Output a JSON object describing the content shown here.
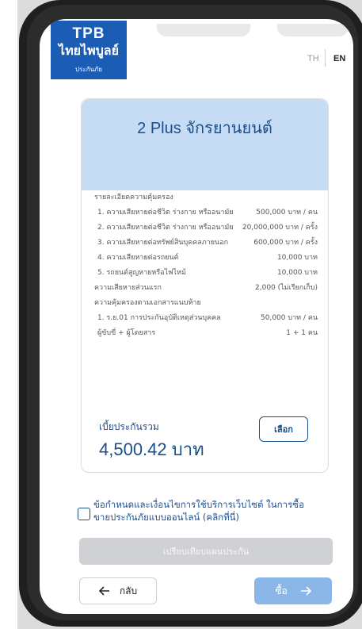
{
  "header": {
    "logo_line1": "TPB",
    "logo_line2": "ไทยไพบูลย์",
    "logo_line3": "ประกันภัย",
    "lang_th": "TH",
    "lang_en": "EN"
  },
  "plan": {
    "title": "2 Plus จักรยานยนต์",
    "coverage_heading": "รายละเอียดความคุ้มครอง",
    "items": [
      {
        "label": "1. ความเสียหายต่อชีวิต ร่างกาย หรืออนามัย",
        "value": "500,000 บาท / คน"
      },
      {
        "label": "2. ความเสียหายต่อชีวิต ร่างกาย หรืออนามัย",
        "value": "20,000,000 บาท / ครั้ง"
      },
      {
        "label": "3. ความเสียหายต่อทรัพย์สินบุคคลภายนอก",
        "value": "600,000 บาท / ครั้ง"
      },
      {
        "label": "4. ความเสียหายต่อรถยนต์",
        "value": "10,000 บาท"
      },
      {
        "label": "5. รถยนต์สูญหายหรือไฟไหม้",
        "value": "10,000 บาท"
      }
    ],
    "deductible_label": "ความเสียหายส่วนแรก",
    "deductible_value": "2,000 (ไม่เรียกเก็บ)",
    "rider_heading": "ความคุ้มครองตามเอกสารแนบท้าย",
    "riders": [
      {
        "label": "1. ร.ย.01 การประกันอุบัติเหตุส่วนบุคคล",
        "value": "50,000 บาท / คน"
      },
      {
        "label": "ผู้ขับขี่ + ผู้โดยสาร",
        "value": "1 + 1 คน"
      }
    ],
    "premium_label": "เบี้ยประกันรวม",
    "premium_value": "4,500.42 บาท",
    "select_label": "เลือก"
  },
  "terms": {
    "text": "ข้อกำหนดและเงื่อนไขการใช้บริการเว็บไซต์ ในการซื้อขายประกันภัยแบบออนไลน์ (คลิกที่นี่)",
    "checked": false
  },
  "actions": {
    "compare_label": "เปรียบเทียบแผนประกัน",
    "back_label": "กลับ",
    "back_icon": "arrow-left-icon",
    "buy_label": "ซื้อ",
    "buy_icon": "arrow-right-icon"
  },
  "colors": {
    "brand_blue": "#1b5cb5",
    "title_blue": "#1b4f8c",
    "card_header": "#c6dcf5",
    "buy_button": "#8ab7e8",
    "compare_button": "#cfd1d4"
  }
}
